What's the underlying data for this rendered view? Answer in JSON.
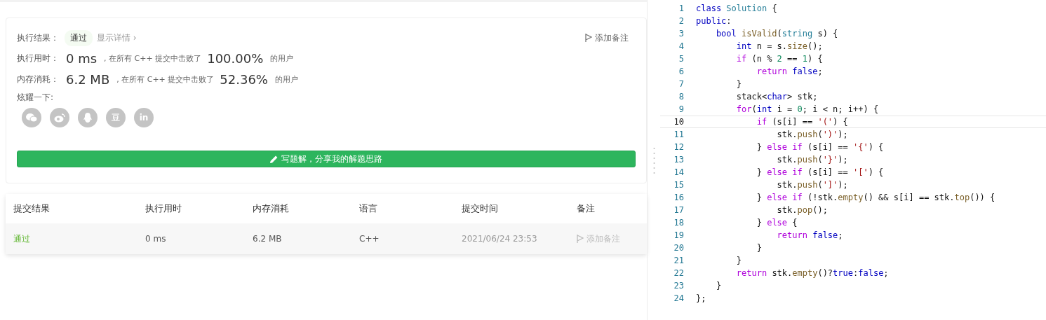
{
  "result": {
    "label": "执行结果：",
    "status": "通过",
    "details": "显示详情 ›",
    "note": "添加备注"
  },
  "stats": [
    {
      "label": "执行用时：",
      "value": "0 ms",
      "prefix": ", 在所有 C++ 提交中击败了",
      "percent": "100.00%",
      "suffix": "的用户"
    },
    {
      "label": "内存消耗：",
      "value": "6.2 MB",
      "prefix": ", 在所有 C++ 提交中击败了",
      "percent": "52.36%",
      "suffix": "的用户"
    }
  ],
  "share": {
    "label": "炫耀一下:",
    "buttons": [
      {
        "kind": "wechat"
      },
      {
        "kind": "weibo"
      },
      {
        "kind": "qq"
      },
      {
        "kind": "text",
        "text": "豆"
      },
      {
        "kind": "text",
        "text": "in"
      }
    ]
  },
  "solution_button": "写题解，分享我的解题思路",
  "table": {
    "columns": [
      "提交结果",
      "执行用时",
      "内存消耗",
      "语言",
      "提交时间",
      "备注"
    ],
    "rows": [
      {
        "status": "通过",
        "time": "0 ms",
        "memory": "6.2 MB",
        "language": "C++",
        "submitted": "2021/06/24 23:53",
        "note": "添加备注"
      }
    ]
  },
  "code": {
    "lines": [
      {
        "number": "1",
        "current": false,
        "segments": [
          {
            "text": "class",
            "kind": "kw"
          },
          {
            "text": " Solution",
            "kind": "type"
          },
          {
            "text": " {",
            "kind": "plain"
          }
        ]
      },
      {
        "number": "2",
        "current": false,
        "segments": [
          {
            "text": "public",
            "kind": "kw"
          },
          {
            "text": ":",
            "kind": "plain"
          }
        ]
      },
      {
        "number": "3",
        "current": false,
        "segments": [
          {
            "text": "    bool",
            "kind": "kw"
          },
          {
            "text": " isValid",
            "kind": "fn"
          },
          {
            "text": "(",
            "kind": "plain"
          },
          {
            "text": "string",
            "kind": "type"
          },
          {
            "text": " s) {",
            "kind": "plain"
          }
        ]
      },
      {
        "number": "4",
        "current": false,
        "segments": [
          {
            "text": "        int",
            "kind": "kw"
          },
          {
            "text": " n = s.",
            "kind": "plain"
          },
          {
            "text": "size",
            "kind": "fn"
          },
          {
            "text": "();",
            "kind": "plain"
          }
        ]
      },
      {
        "number": "5",
        "current": false,
        "segments": [
          {
            "text": "        if",
            "kind": "ctrl"
          },
          {
            "text": " (n % ",
            "kind": "plain"
          },
          {
            "text": "2",
            "kind": "num"
          },
          {
            "text": " == ",
            "kind": "plain"
          },
          {
            "text": "1",
            "kind": "num"
          },
          {
            "text": ") {",
            "kind": "plain"
          }
        ]
      },
      {
        "number": "6",
        "current": false,
        "segments": [
          {
            "text": "            return",
            "kind": "ctrl"
          },
          {
            "text": " false",
            "kind": "kw"
          },
          {
            "text": ";",
            "kind": "plain"
          }
        ]
      },
      {
        "number": "7",
        "current": false,
        "segments": [
          {
            "text": "        }",
            "kind": "plain"
          }
        ]
      },
      {
        "number": "8",
        "current": false,
        "segments": [
          {
            "text": "        stack<",
            "kind": "plain"
          },
          {
            "text": "char",
            "kind": "kw"
          },
          {
            "text": "> stk;",
            "kind": "plain"
          }
        ]
      },
      {
        "number": "9",
        "current": false,
        "segments": [
          {
            "text": "        for",
            "kind": "ctrl"
          },
          {
            "text": "(",
            "kind": "plain"
          },
          {
            "text": "int",
            "kind": "kw"
          },
          {
            "text": " i = ",
            "kind": "plain"
          },
          {
            "text": "0",
            "kind": "num"
          },
          {
            "text": "; i < n; i++) {",
            "kind": "plain"
          }
        ]
      },
      {
        "number": "10",
        "current": true,
        "segments": [
          {
            "text": "            if",
            "kind": "ctrl"
          },
          {
            "text": " (s[i] == ",
            "kind": "plain"
          },
          {
            "text": "'('",
            "kind": "str"
          },
          {
            "text": ") {",
            "kind": "plain"
          }
        ]
      },
      {
        "number": "11",
        "current": false,
        "segments": [
          {
            "text": "                stk.",
            "kind": "plain"
          },
          {
            "text": "push",
            "kind": "fn"
          },
          {
            "text": "(",
            "kind": "plain"
          },
          {
            "text": "')'",
            "kind": "str"
          },
          {
            "text": ");",
            "kind": "plain"
          }
        ]
      },
      {
        "number": "12",
        "current": false,
        "segments": [
          {
            "text": "            } ",
            "kind": "plain"
          },
          {
            "text": "else if",
            "kind": "ctrl"
          },
          {
            "text": " (s[i] == ",
            "kind": "plain"
          },
          {
            "text": "'{'",
            "kind": "str"
          },
          {
            "text": ") {",
            "kind": "plain"
          }
        ]
      },
      {
        "number": "13",
        "current": false,
        "segments": [
          {
            "text": "                stk.",
            "kind": "plain"
          },
          {
            "text": "push",
            "kind": "fn"
          },
          {
            "text": "(",
            "kind": "plain"
          },
          {
            "text": "'}'",
            "kind": "str"
          },
          {
            "text": ");",
            "kind": "plain"
          }
        ]
      },
      {
        "number": "14",
        "current": false,
        "segments": [
          {
            "text": "            } ",
            "kind": "plain"
          },
          {
            "text": "else if",
            "kind": "ctrl"
          },
          {
            "text": " (s[i] == ",
            "kind": "plain"
          },
          {
            "text": "'['",
            "kind": "str"
          },
          {
            "text": ") {",
            "kind": "plain"
          }
        ]
      },
      {
        "number": "15",
        "current": false,
        "segments": [
          {
            "text": "                stk.",
            "kind": "plain"
          },
          {
            "text": "push",
            "kind": "fn"
          },
          {
            "text": "(",
            "kind": "plain"
          },
          {
            "text": "']'",
            "kind": "str"
          },
          {
            "text": ");",
            "kind": "plain"
          }
        ]
      },
      {
        "number": "16",
        "current": false,
        "segments": [
          {
            "text": "            } ",
            "kind": "plain"
          },
          {
            "text": "else if",
            "kind": "ctrl"
          },
          {
            "text": " (!stk.",
            "kind": "plain"
          },
          {
            "text": "empty",
            "kind": "fn"
          },
          {
            "text": "() && s[i] == stk.",
            "kind": "plain"
          },
          {
            "text": "top",
            "kind": "fn"
          },
          {
            "text": "()) {",
            "kind": "plain"
          }
        ]
      },
      {
        "number": "17",
        "current": false,
        "segments": [
          {
            "text": "                stk.",
            "kind": "plain"
          },
          {
            "text": "pop",
            "kind": "fn"
          },
          {
            "text": "();",
            "kind": "plain"
          }
        ]
      },
      {
        "number": "18",
        "current": false,
        "segments": [
          {
            "text": "            } ",
            "kind": "plain"
          },
          {
            "text": "else",
            "kind": "ctrl"
          },
          {
            "text": " {",
            "kind": "plain"
          }
        ]
      },
      {
        "number": "19",
        "current": false,
        "segments": [
          {
            "text": "                return",
            "kind": "ctrl"
          },
          {
            "text": " false",
            "kind": "kw"
          },
          {
            "text": ";",
            "kind": "plain"
          }
        ]
      },
      {
        "number": "20",
        "current": false,
        "segments": [
          {
            "text": "            }",
            "kind": "plain"
          }
        ]
      },
      {
        "number": "21",
        "current": false,
        "segments": [
          {
            "text": "        }",
            "kind": "plain"
          }
        ]
      },
      {
        "number": "22",
        "current": false,
        "segments": [
          {
            "text": "        return",
            "kind": "ctrl"
          },
          {
            "text": " stk.",
            "kind": "plain"
          },
          {
            "text": "empty",
            "kind": "fn"
          },
          {
            "text": "()?",
            "kind": "plain"
          },
          {
            "text": "true",
            "kind": "kw"
          },
          {
            "text": ":",
            "kind": "plain"
          },
          {
            "text": "false",
            "kind": "kw"
          },
          {
            "text": ";",
            "kind": "plain"
          }
        ]
      },
      {
        "number": "23",
        "current": false,
        "segments": [
          {
            "text": "    }",
            "kind": "plain"
          }
        ]
      },
      {
        "number": "24",
        "current": false,
        "segments": [
          {
            "text": "};",
            "kind": "plain"
          }
        ]
      }
    ]
  }
}
